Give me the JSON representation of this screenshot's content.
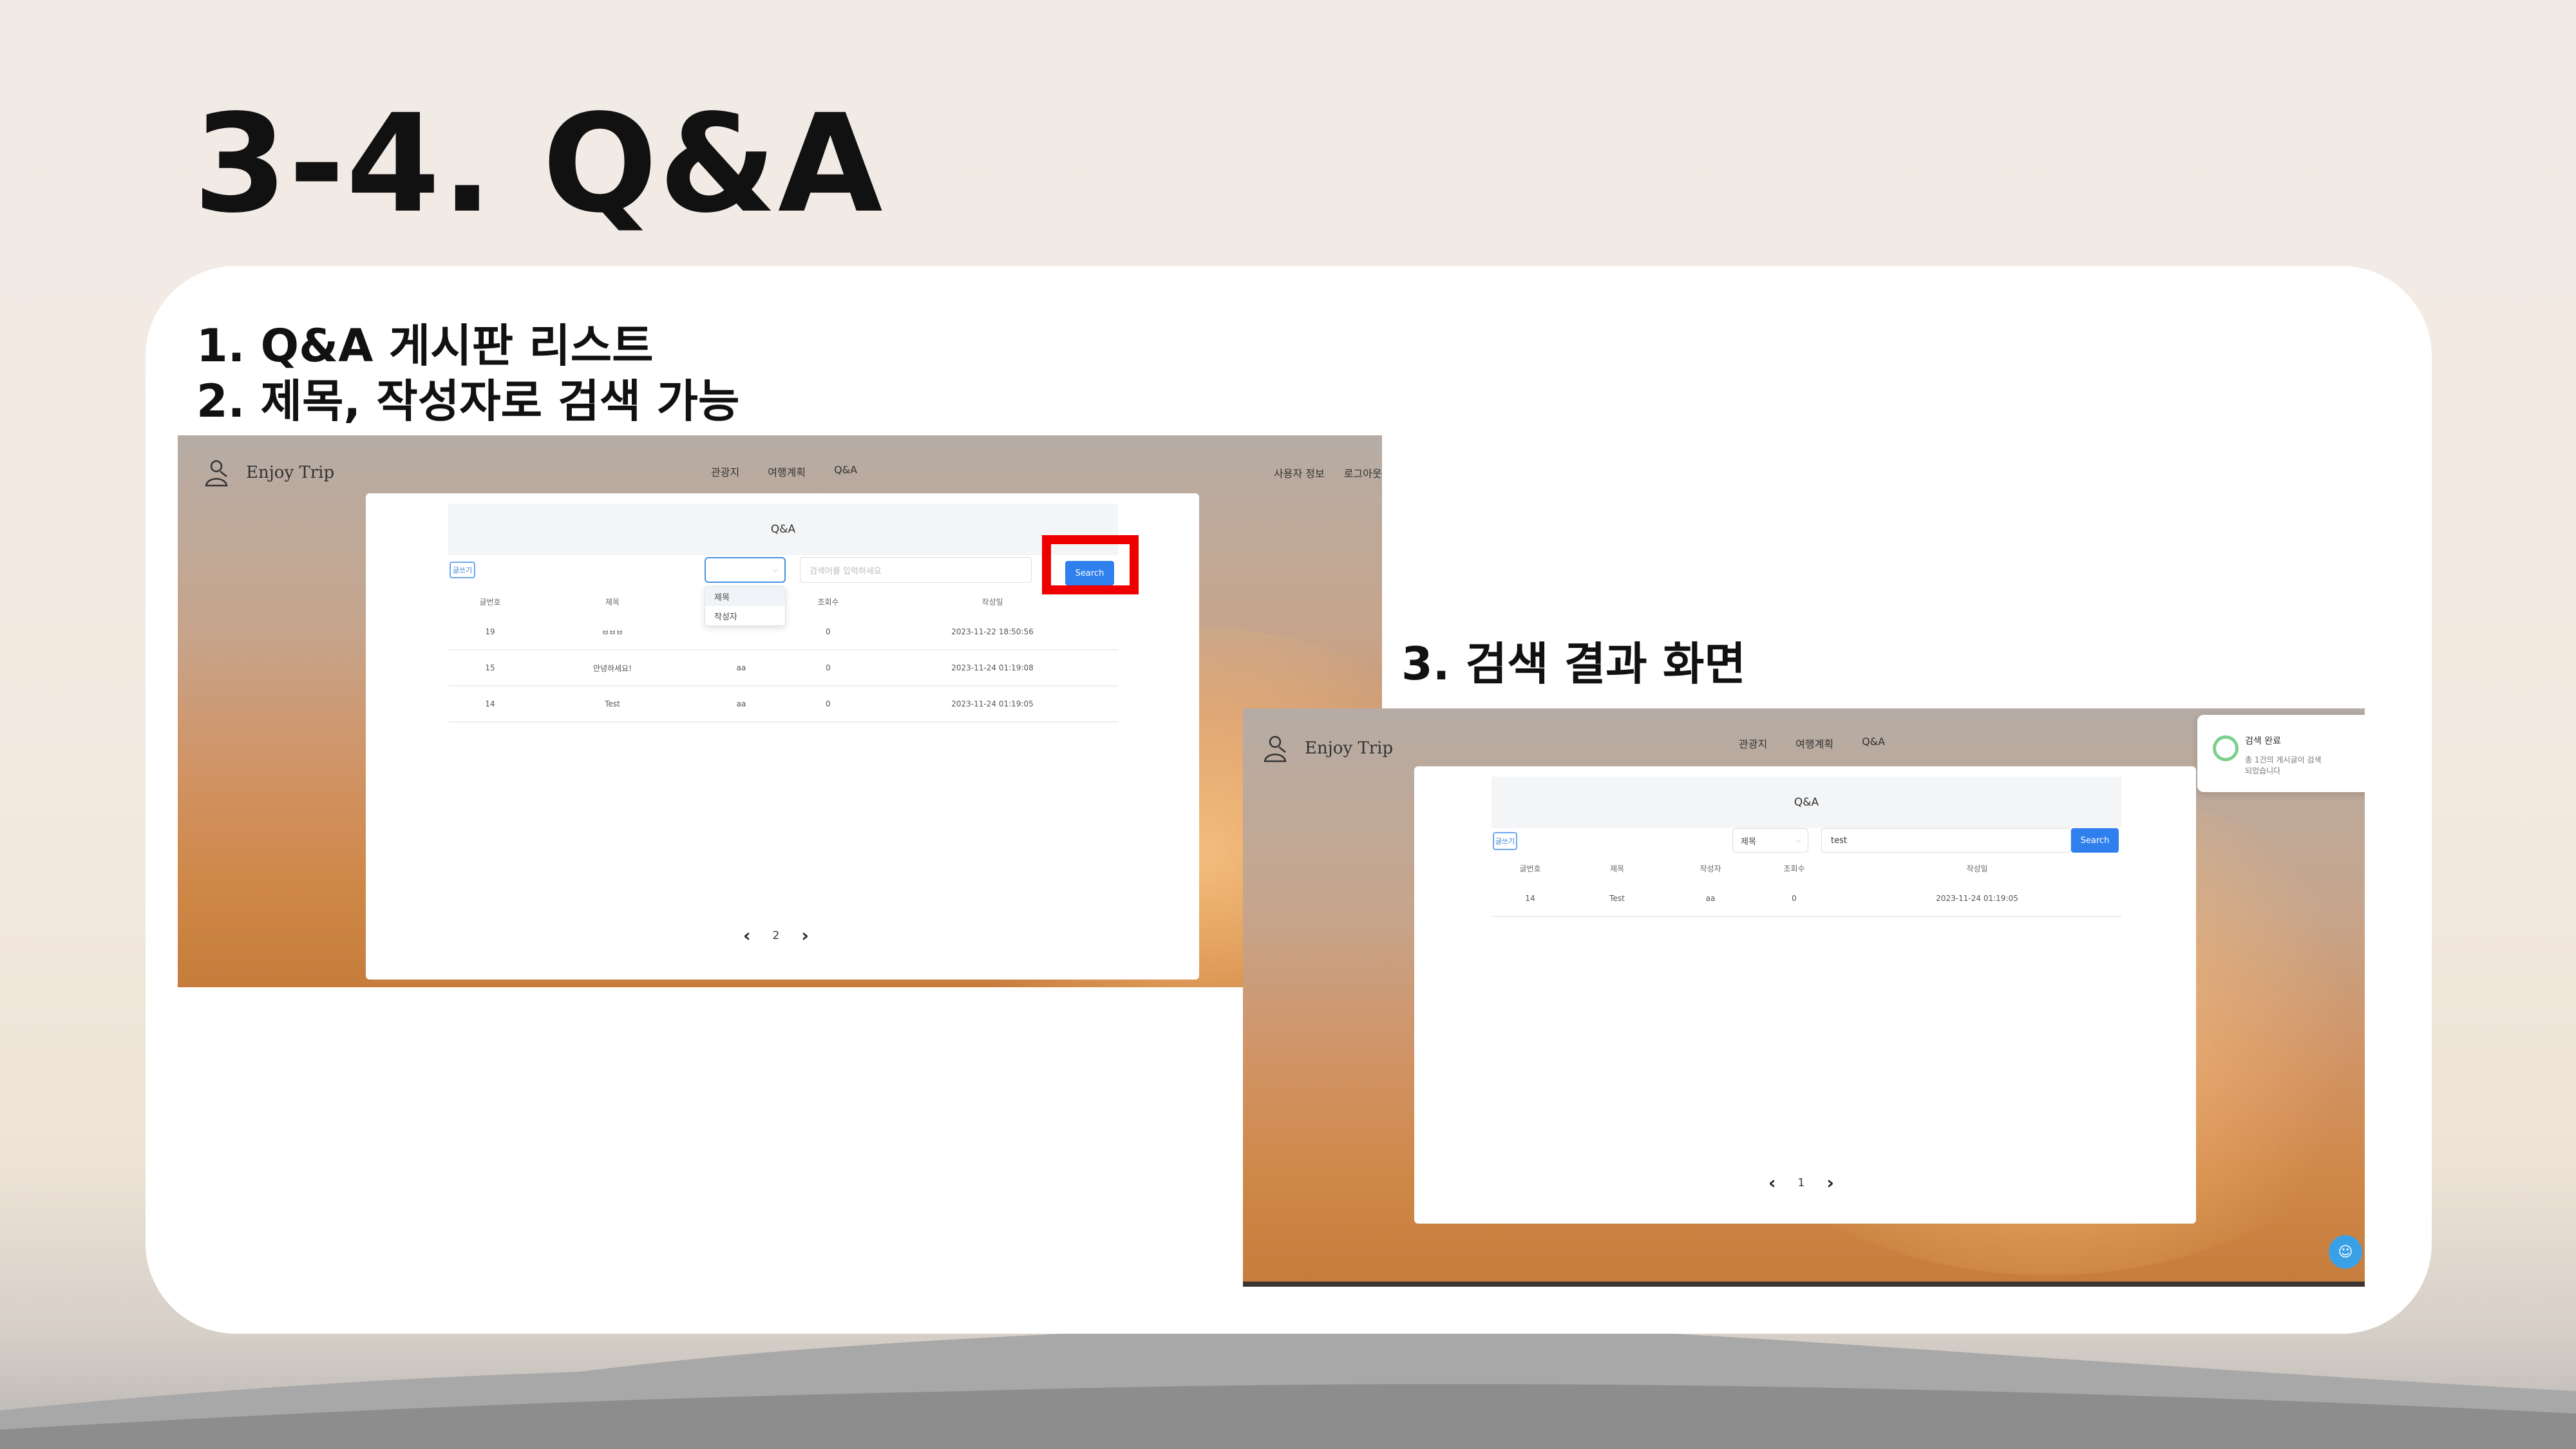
{
  "slide": {
    "title": "3-4. Q&A",
    "caption1": "1. Q&A 게시판 리스트",
    "caption2": "2. 제목, 작성자로 검색 가능",
    "caption3": "3. 검색 결과 화면"
  },
  "app": {
    "logo_text": "Enjoy Trip",
    "nav": [
      "관광지",
      "여행계획",
      "Q&A"
    ],
    "user_nav": [
      "사용자 정보",
      "로그아웃"
    ],
    "board_title": "Q&A",
    "write_label": "글쓰기",
    "search_button": "Search",
    "columns": [
      "글번호",
      "제목",
      "작성자",
      "조회수",
      "작성일"
    ]
  },
  "screen1": {
    "select_value": "",
    "search_placeholder": "검색어를 입력하세요",
    "dropdown_options": [
      "제목",
      "작성자"
    ],
    "rows": [
      {
        "no": "19",
        "title": "ㅂㅂㅂ",
        "author": "",
        "views": "0",
        "date": "2023-11-22 18:50:56"
      },
      {
        "no": "15",
        "title": "안녕하세요!",
        "author": "aa",
        "views": "0",
        "date": "2023-11-24 01:19:08"
      },
      {
        "no": "14",
        "title": "Test",
        "author": "aa",
        "views": "0",
        "date": "2023-11-24 01:19:05"
      }
    ],
    "page": "2"
  },
  "screen2": {
    "select_value": "제목",
    "search_value": "test",
    "rows": [
      {
        "no": "14",
        "title": "Test",
        "author": "aa",
        "views": "0",
        "date": "2023-11-24 01:19:05"
      }
    ],
    "page": "1",
    "toast_title": "검색 완료",
    "toast_message": "총 1건의 게시글이 검색 되었습니다"
  },
  "colors": {
    "search_button": "#2f80ed",
    "highlight_box": "#ee0000",
    "toast_icon": "#7bd08a"
  }
}
